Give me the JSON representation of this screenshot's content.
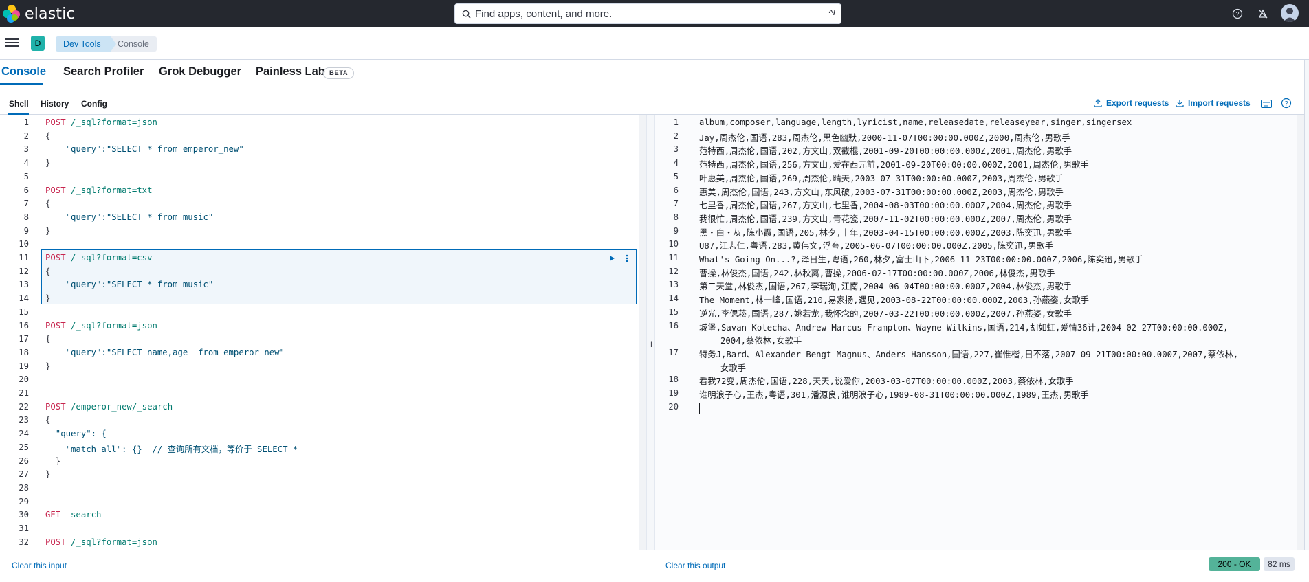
{
  "header": {
    "brand": "elastic",
    "search_placeholder": "Find apps, content, and more.",
    "search_shortcut": "^/"
  },
  "breadcrumbs": {
    "space_initial": "D",
    "items": [
      "Dev Tools",
      "Console"
    ]
  },
  "main_tabs": [
    {
      "label": "Console",
      "active": true
    },
    {
      "label": "Search Profiler"
    },
    {
      "label": "Grok Debugger"
    },
    {
      "label": "Painless Lab"
    }
  ],
  "beta_label": "BETA",
  "console_tabs": [
    "Shell",
    "History",
    "Config"
  ],
  "actions": {
    "export": "Export requests",
    "import": "Import requests"
  },
  "input_lines": [
    {
      "n": "1",
      "t": "POST /_sql?format=json"
    },
    {
      "n": "2",
      "t": "{"
    },
    {
      "n": "3",
      "t": "    \"query\":\"SELECT * from emperor_new\""
    },
    {
      "n": "4",
      "t": "}"
    },
    {
      "n": "5",
      "t": ""
    },
    {
      "n": "6",
      "t": "POST /_sql?format=txt"
    },
    {
      "n": "7",
      "t": "{"
    },
    {
      "n": "8",
      "t": "    \"query\":\"SELECT * from music\""
    },
    {
      "n": "9",
      "t": "}"
    },
    {
      "n": "10",
      "t": ""
    },
    {
      "n": "11",
      "t": "POST /_sql?format=csv"
    },
    {
      "n": "12",
      "t": "{"
    },
    {
      "n": "13",
      "t": "    \"query\":\"SELECT * from music\""
    },
    {
      "n": "14",
      "t": "}"
    },
    {
      "n": "15",
      "t": ""
    },
    {
      "n": "16",
      "t": "POST /_sql?format=json"
    },
    {
      "n": "17",
      "t": "{"
    },
    {
      "n": "18",
      "t": "    \"query\":\"SELECT name,age  from emperor_new\""
    },
    {
      "n": "19",
      "t": "}"
    },
    {
      "n": "20",
      "t": ""
    },
    {
      "n": "21",
      "t": ""
    },
    {
      "n": "22",
      "t": "POST /emperor_new/_search"
    },
    {
      "n": "23",
      "t": "{"
    },
    {
      "n": "24",
      "t": "  \"query\": {"
    },
    {
      "n": "25",
      "t": "    \"match_all\": {}  // 查询所有文档，等价于 SELECT *"
    },
    {
      "n": "26",
      "t": "  }"
    },
    {
      "n": "27",
      "t": "}"
    },
    {
      "n": "28",
      "t": ""
    },
    {
      "n": "29",
      "t": ""
    },
    {
      "n": "30",
      "t": "GET _search"
    },
    {
      "n": "31",
      "t": ""
    },
    {
      "n": "32",
      "t": "POST /_sql?format=json"
    }
  ],
  "output_lines": [
    {
      "n": "1",
      "t": "album,composer,language,length,lyricist,name,releasedate,releaseyear,singer,singersex"
    },
    {
      "n": "2",
      "t": "Jay,周杰伦,国语,283,周杰伦,黑色幽默,2000-11-07T00:00:00.000Z,2000,周杰伦,男歌手"
    },
    {
      "n": "3",
      "t": "范特西,周杰伦,国语,202,方文山,双截棍,2001-09-20T00:00:00.000Z,2001,周杰伦,男歌手"
    },
    {
      "n": "4",
      "t": "范特西,周杰伦,国语,256,方文山,爱在西元前,2001-09-20T00:00:00.000Z,2001,周杰伦,男歌手"
    },
    {
      "n": "5",
      "t": "叶惠美,周杰伦,国语,269,周杰伦,晴天,2003-07-31T00:00:00.000Z,2003,周杰伦,男歌手"
    },
    {
      "n": "6",
      "t": "惠美,周杰伦,国语,243,方文山,东风破,2003-07-31T00:00:00.000Z,2003,周杰伦,男歌手"
    },
    {
      "n": "7",
      "t": "七里香,周杰伦,国语,267,方文山,七里香,2004-08-03T00:00:00.000Z,2004,周杰伦,男歌手"
    },
    {
      "n": "8",
      "t": "我很忙,周杰伦,国语,239,方文山,青花瓷,2007-11-02T00:00:00.000Z,2007,周杰伦,男歌手"
    },
    {
      "n": "9",
      "t": "黑・白・灰,陈小霞,国语,205,林夕,十年,2003-04-15T00:00:00.000Z,2003,陈奕迅,男歌手"
    },
    {
      "n": "10",
      "t": "U87,江志仁,粤语,283,黄伟文,浮夸,2005-06-07T00:00:00.000Z,2005,陈奕迅,男歌手"
    },
    {
      "n": "11",
      "t": "What's Going On...?,泽日生,粤语,260,林夕,富士山下,2006-11-23T00:00:00.000Z,2006,陈奕迅,男歌手"
    },
    {
      "n": "12",
      "t": "曹操,林俊杰,国语,242,林秋离,曹操,2006-02-17T00:00:00.000Z,2006,林俊杰,男歌手"
    },
    {
      "n": "13",
      "t": "第二天堂,林俊杰,国语,267,李瑞洵,江南,2004-06-04T00:00:00.000Z,2004,林俊杰,男歌手"
    },
    {
      "n": "14",
      "t": "The Moment,林一峰,国语,210,易家扬,遇见,2003-08-22T00:00:00.000Z,2003,孙燕姿,女歌手"
    },
    {
      "n": "15",
      "t": "逆光,李偲菘,国语,287,姚若龙,我怀念的,2007-03-22T00:00:00.000Z,2007,孙燕姿,女歌手"
    },
    {
      "n": "16",
      "t": "城堡,Savan Kotecha、Andrew Marcus Frampton、Wayne Wilkins,国语,214,胡如虹,爱情36计,2004-02-27T00:00:00.000Z,",
      "t2": "2004,蔡依林,女歌手"
    },
    {
      "n": "17",
      "t": "特务J,Bard、Alexander Bengt Magnus、Anders Hansson,国语,227,崔惟楷,日不落,2007-09-21T00:00:00.000Z,2007,蔡依林,",
      "t2": "女歌手"
    },
    {
      "n": "18",
      "t": "看我72变,周杰伦,国语,228,天天,说爱你,2003-03-07T00:00:00.000Z,2003,蔡依林,女歌手"
    },
    {
      "n": "19",
      "t": "谁明浪子心,王杰,粤语,301,潘源良,谁明浪子心,1989-08-31T00:00:00.000Z,1989,王杰,男歌手"
    },
    {
      "n": "20",
      "t": ""
    }
  ],
  "footer": {
    "clear_input": "Clear this input",
    "clear_output": "Clear this output",
    "status": "200 - OK",
    "duration": "82 ms"
  }
}
